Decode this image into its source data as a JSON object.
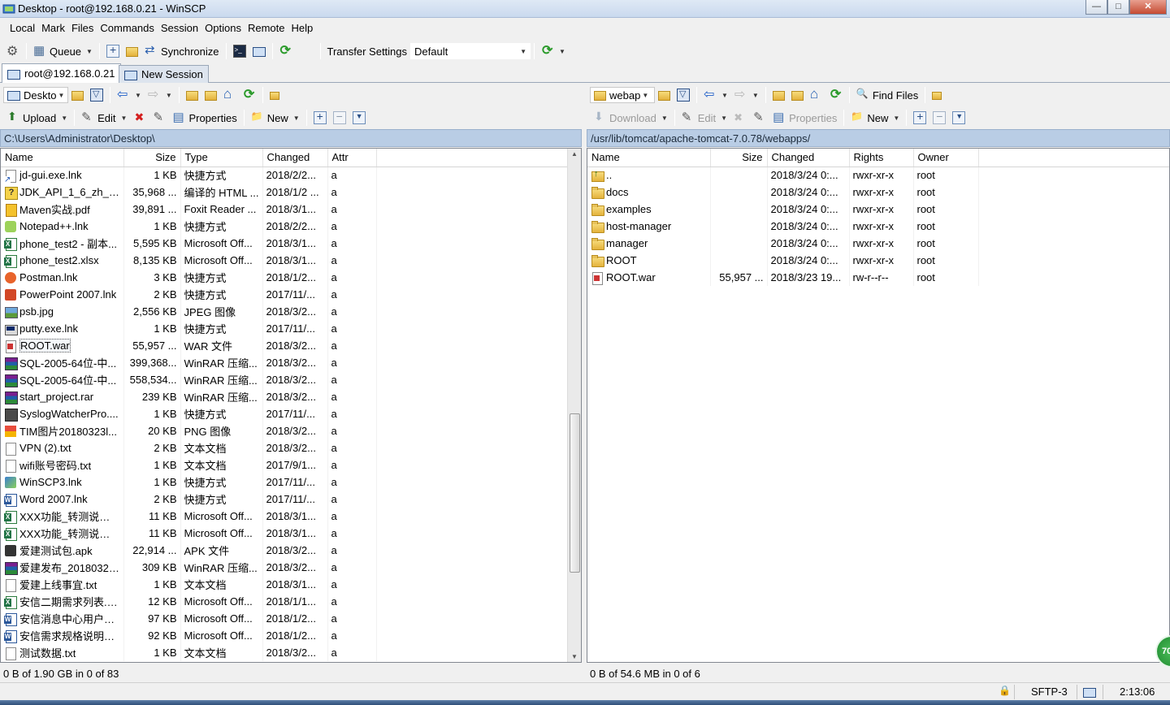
{
  "window": {
    "title": "Desktop - root@192.168.0.21 - WinSCP",
    "controls": [
      "—",
      "□",
      "✕"
    ]
  },
  "menu": [
    "Local",
    "Mark",
    "Files",
    "Commands",
    "Session",
    "Options",
    "Remote",
    "Help"
  ],
  "toolbar": {
    "queue_label": "Queue",
    "synchronize_label": "Synchronize",
    "transfer_settings_label": "Transfer Settings",
    "transfer_settings_value": "Default"
  },
  "tabs": {
    "session": "root@192.168.0.21",
    "new_session": "New Session"
  },
  "local": {
    "location": "Deskto",
    "upload_label": "Upload",
    "edit_label": "Edit",
    "properties_label": "Properties",
    "new_label": "New",
    "path": "C:\\Users\\Administrator\\Desktop\\",
    "columns": [
      "Name",
      "Size",
      "Type",
      "Changed",
      "Attr"
    ],
    "files": [
      {
        "icon": "lnk",
        "name": "jd-gui.exe.lnk",
        "size": "1 KB",
        "type": "快捷方式",
        "changed": "2018/2/2...",
        "attr": "a"
      },
      {
        "icon": "html",
        "name": "JDK_API_1_6_zh_CN....",
        "size": "35,968 ...",
        "type": "编译的 HTML ...",
        "changed": "2018/1/2 ...",
        "attr": "a"
      },
      {
        "icon": "pdf",
        "name": "Maven实战.pdf",
        "size": "39,891 ...",
        "type": "Foxit Reader ...",
        "changed": "2018/3/1...",
        "attr": "a"
      },
      {
        "icon": "npp",
        "name": "Notepad++.lnk",
        "size": "1 KB",
        "type": "快捷方式",
        "changed": "2018/2/2...",
        "attr": "a"
      },
      {
        "icon": "xls",
        "name": "phone_test2 - 副本...",
        "size": "5,595 KB",
        "type": "Microsoft Off...",
        "changed": "2018/3/1...",
        "attr": "a"
      },
      {
        "icon": "xls",
        "name": "phone_test2.xlsx",
        "size": "8,135 KB",
        "type": "Microsoft Off...",
        "changed": "2018/3/1...",
        "attr": "a"
      },
      {
        "icon": "orange",
        "name": "Postman.lnk",
        "size": "3 KB",
        "type": "快捷方式",
        "changed": "2018/1/2...",
        "attr": "a"
      },
      {
        "icon": "ppt",
        "name": "PowerPoint 2007.lnk",
        "size": "2 KB",
        "type": "快捷方式",
        "changed": "2017/11/...",
        "attr": "a"
      },
      {
        "icon": "img",
        "name": "psb.jpg",
        "size": "2,556 KB",
        "type": "JPEG 图像",
        "changed": "2018/3/2...",
        "attr": "a"
      },
      {
        "icon": "putty",
        "name": "putty.exe.lnk",
        "size": "1 KB",
        "type": "快捷方式",
        "changed": "2017/11/...",
        "attr": "a"
      },
      {
        "icon": "war",
        "name": "ROOT.war",
        "size": "55,957 ...",
        "type": "WAR 文件",
        "changed": "2018/3/2...",
        "attr": "a",
        "selected": true
      },
      {
        "icon": "rar",
        "name": "SQL-2005-64位-中...",
        "size": "399,368...",
        "type": "WinRAR 压缩...",
        "changed": "2018/3/2...",
        "attr": "a"
      },
      {
        "icon": "rar",
        "name": "SQL-2005-64位-中...",
        "size": "558,534...",
        "type": "WinRAR 压缩...",
        "changed": "2018/3/2...",
        "attr": "a"
      },
      {
        "icon": "rar",
        "name": "start_project.rar",
        "size": "239 KB",
        "type": "WinRAR 压缩...",
        "changed": "2018/3/2...",
        "attr": "a"
      },
      {
        "icon": "syslog",
        "name": "SyslogWatcherPro....",
        "size": "1 KB",
        "type": "快捷方式",
        "changed": "2017/11/...",
        "attr": "a"
      },
      {
        "icon": "tim",
        "name": "TIM图片20180323l...",
        "size": "20 KB",
        "type": "PNG 图像",
        "changed": "2018/3/2...",
        "attr": "a"
      },
      {
        "icon": "doc",
        "name": "VPN (2).txt",
        "size": "2 KB",
        "type": "文本文档",
        "changed": "2018/3/2...",
        "attr": "a"
      },
      {
        "icon": "doc",
        "name": "wifi账号密码.txt",
        "size": "1 KB",
        "type": "文本文档",
        "changed": "2017/9/1...",
        "attr": "a"
      },
      {
        "icon": "winscp",
        "name": "WinSCP3.lnk",
        "size": "1 KB",
        "type": "快捷方式",
        "changed": "2017/11/...",
        "attr": "a"
      },
      {
        "icon": "word",
        "name": "Word 2007.lnk",
        "size": "2 KB",
        "type": "快捷方式",
        "changed": "2017/11/...",
        "attr": "a"
      },
      {
        "icon": "xls",
        "name": "XXX功能_转测说明文...",
        "size": "11 KB",
        "type": "Microsoft Off...",
        "changed": "2018/3/1...",
        "attr": "a"
      },
      {
        "icon": "xls",
        "name": "XXX功能_转测说明文...",
        "size": "11 KB",
        "type": "Microsoft Off...",
        "changed": "2018/3/1...",
        "attr": "a"
      },
      {
        "icon": "apk",
        "name": "爱建测试包.apk",
        "size": "22,914 ...",
        "type": "APK 文件",
        "changed": "2018/3/2...",
        "attr": "a"
      },
      {
        "icon": "rar",
        "name": "爱建发布_20180323....",
        "size": "309 KB",
        "type": "WinRAR 压缩...",
        "changed": "2018/3/2...",
        "attr": "a"
      },
      {
        "icon": "doc",
        "name": "爱建上线事宜.txt",
        "size": "1 KB",
        "type": "文本文档",
        "changed": "2018/3/1...",
        "attr": "a"
      },
      {
        "icon": "xls",
        "name": "安信二期需求列表.xlsx",
        "size": "12 KB",
        "type": "Microsoft Off...",
        "changed": "2018/1/1...",
        "attr": "a"
      },
      {
        "icon": "word",
        "name": "安信消息中心用户行...",
        "size": "97 KB",
        "type": "Microsoft Off...",
        "changed": "2018/1/2...",
        "attr": "a"
      },
      {
        "icon": "word",
        "name": "安信需求规格说明书_...",
        "size": "92 KB",
        "type": "Microsoft Off...",
        "changed": "2018/1/2...",
        "attr": "a"
      },
      {
        "icon": "doc",
        "name": "测试数据.txt",
        "size": "1 KB",
        "type": "文本文档",
        "changed": "2018/3/2...",
        "attr": "a"
      }
    ],
    "status": "0 B of 1.90 GB in 0 of 83"
  },
  "remote": {
    "location": "webap",
    "find_files_label": "Find Files",
    "download_label": "Download",
    "edit_label": "Edit",
    "properties_label": "Properties",
    "new_label": "New",
    "path": "/usr/lib/tomcat/apache-tomcat-7.0.78/webapps/",
    "columns": [
      "Name",
      "Size",
      "Changed",
      "Rights",
      "Owner"
    ],
    "files": [
      {
        "icon": "up",
        "name": "..",
        "size": "",
        "changed": "2018/3/24 0:...",
        "rights": "rwxr-xr-x",
        "owner": "root"
      },
      {
        "icon": "folder",
        "name": "docs",
        "size": "",
        "changed": "2018/3/24 0:...",
        "rights": "rwxr-xr-x",
        "owner": "root"
      },
      {
        "icon": "folder",
        "name": "examples",
        "size": "",
        "changed": "2018/3/24 0:...",
        "rights": "rwxr-xr-x",
        "owner": "root"
      },
      {
        "icon": "folder",
        "name": "host-manager",
        "size": "",
        "changed": "2018/3/24 0:...",
        "rights": "rwxr-xr-x",
        "owner": "root"
      },
      {
        "icon": "folder",
        "name": "manager",
        "size": "",
        "changed": "2018/3/24 0:...",
        "rights": "rwxr-xr-x",
        "owner": "root"
      },
      {
        "icon": "folder",
        "name": "ROOT",
        "size": "",
        "changed": "2018/3/24 0:...",
        "rights": "rwxr-xr-x",
        "owner": "root"
      },
      {
        "icon": "war",
        "name": "ROOT.war",
        "size": "55,957 ...",
        "changed": "2018/3/23 19...",
        "rights": "rw-r--r--",
        "owner": "root"
      }
    ],
    "status": "0 B of 54.6 MB in 0 of 6"
  },
  "statusbar": {
    "protocol": "SFTP-3",
    "elapsed": "2:13:06",
    "badge": "70"
  }
}
